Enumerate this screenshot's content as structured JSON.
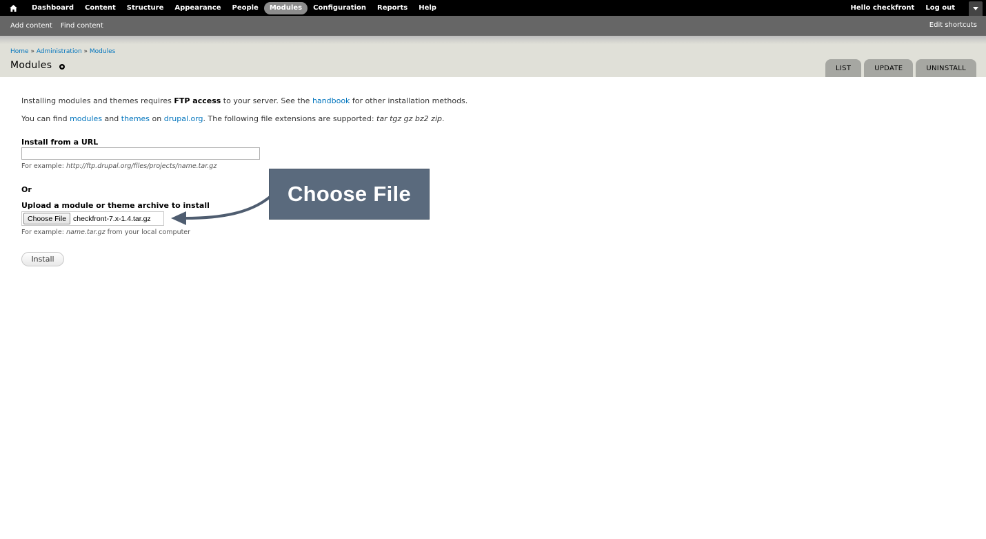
{
  "toolbar": {
    "nav": [
      "Dashboard",
      "Content",
      "Structure",
      "Appearance",
      "People",
      "Modules",
      "Configuration",
      "Reports",
      "Help"
    ],
    "active": "Modules",
    "hello_prefix": "Hello ",
    "username": "checkfront",
    "logout": "Log out"
  },
  "shortcuts": {
    "add_content": "Add content",
    "find_content": "Find content",
    "edit_shortcuts": "Edit shortcuts"
  },
  "breadcrumb": [
    "Home",
    "Administration",
    "Modules"
  ],
  "breadcrumb_sep": " » ",
  "page_title": "Modules",
  "tabs": [
    "LIST",
    "UPDATE",
    "UNINSTALL"
  ],
  "content": {
    "p1_a": "Installing modules and themes requires ",
    "p1_b": "FTP access",
    "p1_c": " to your server. See the ",
    "p1_link": "handbook",
    "p1_d": " for other installation methods.",
    "p2_a": "You can find ",
    "p2_link1": "modules",
    "p2_b": " and ",
    "p2_link2": "themes",
    "p2_c": " on ",
    "p2_link3": "drupal.org",
    "p2_d": ". The following file extensions are supported: ",
    "p2_ext": "tar tgz gz bz2 zip",
    "p2_e": ".",
    "url_label": "Install from a URL",
    "url_value": "",
    "url_desc_a": "For example: ",
    "url_desc_b": "http://ftp.drupal.org/files/projects/name.tar.gz",
    "or": "Or",
    "upload_label": "Upload a module or theme archive to install",
    "choose_file": "Choose File",
    "file_name": "checkfront-7.x-1.4.tar.gz",
    "upload_desc_a": "For example: ",
    "upload_desc_b": "name.tar.gz",
    "upload_desc_c": " from your local computer",
    "install": "Install"
  },
  "callout": {
    "text": "Choose File",
    "color": "#5a6a7d"
  },
  "icons": {
    "home": "home-icon",
    "gear": "gear-icon",
    "drawer": "chevron-down-icon"
  }
}
